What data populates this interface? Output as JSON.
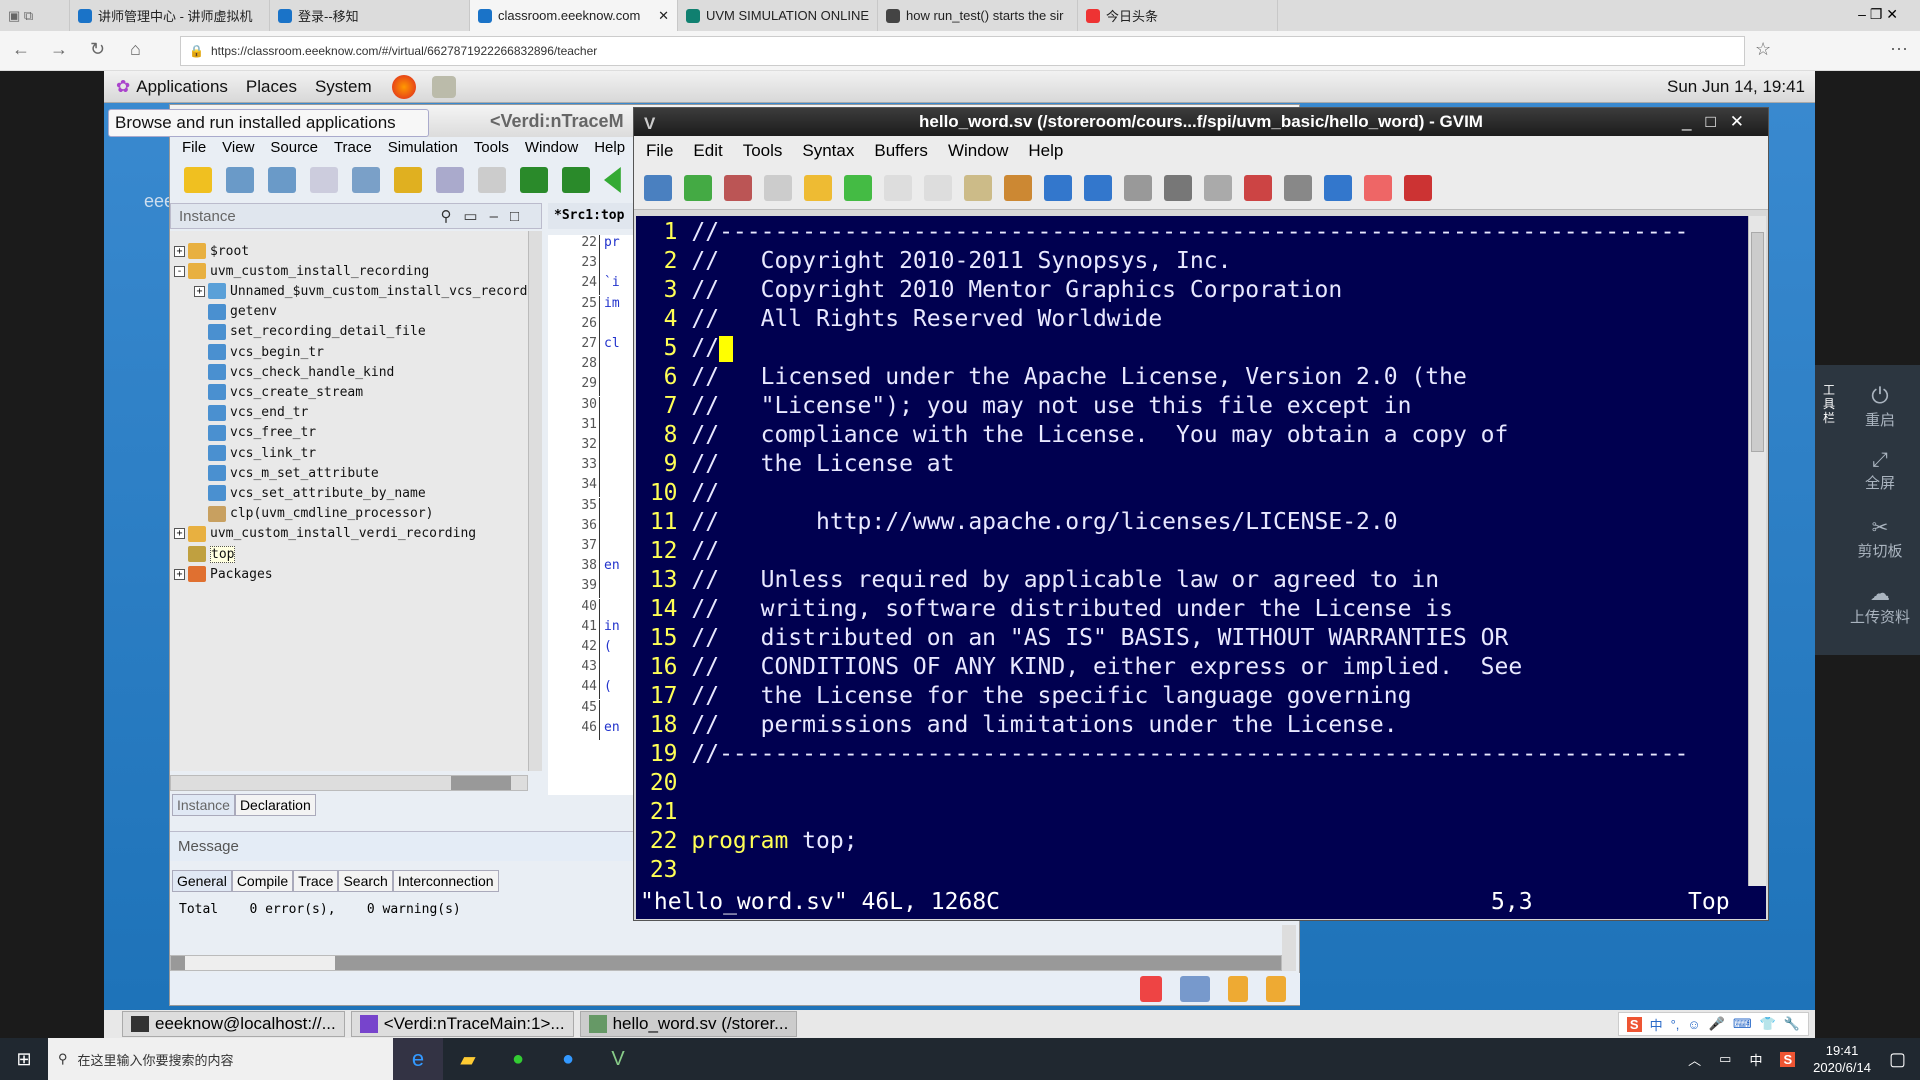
{
  "browser": {
    "tabs": [
      {
        "label": "讲师管理中心 - 讲师虚拟机",
        "color": "#1a73c8",
        "active": false
      },
      {
        "label": "登录--移知",
        "color": "#1a73c8",
        "active": false
      },
      {
        "label": "classroom.eeeknow.com",
        "color": "#1a73c8",
        "active": true
      },
      {
        "label": "UVM SIMULATION ONLINE",
        "color": "#108070",
        "active": false
      },
      {
        "label": "how run_test() starts the sir",
        "color": "#444444",
        "active": false
      },
      {
        "label": "今日头条",
        "color": "#e33",
        "active": false
      }
    ],
    "url": "https://classroom.eeeknow.com/#/virtual/6627871922266832896/teacher"
  },
  "gnome_panel": {
    "menus": [
      "Applications",
      "Places",
      "System"
    ],
    "clock": "Sun Jun 14, 19:41"
  },
  "tooltip": "Browse and run installed applications",
  "desktop_label": "eee",
  "verdi": {
    "title": "<Verdi:nTraceM",
    "menu": [
      "File",
      "View",
      "Source",
      "Trace",
      "Simulation",
      "Tools",
      "Window",
      "Help"
    ],
    "instance_header": "Instance",
    "source_tab": "*Src1:top",
    "tree": [
      {
        "label": "$root",
        "level": 0,
        "expander": "+",
        "icon": "module"
      },
      {
        "label": "uvm_custom_install_recording",
        "level": 0,
        "expander": "-",
        "icon": "module"
      },
      {
        "label": "Unnamed_$uvm_custom_install_vcs_recorde",
        "level": 1,
        "expander": "+",
        "icon": "block"
      },
      {
        "label": "getenv",
        "level": 1,
        "expander": "",
        "icon": "function"
      },
      {
        "label": "set_recording_detail_file",
        "level": 1,
        "expander": "",
        "icon": "function"
      },
      {
        "label": "vcs_begin_tr",
        "level": 1,
        "expander": "",
        "icon": "function"
      },
      {
        "label": "vcs_check_handle_kind",
        "level": 1,
        "expander": "",
        "icon": "function"
      },
      {
        "label": "vcs_create_stream",
        "level": 1,
        "expander": "",
        "icon": "function"
      },
      {
        "label": "vcs_end_tr",
        "level": 1,
        "expander": "",
        "icon": "function"
      },
      {
        "label": "vcs_free_tr",
        "level": 1,
        "expander": "",
        "icon": "function"
      },
      {
        "label": "vcs_link_tr",
        "level": 1,
        "expander": "",
        "icon": "function"
      },
      {
        "label": "vcs_m_set_attribute",
        "level": 1,
        "expander": "",
        "icon": "function"
      },
      {
        "label": "vcs_set_attribute_by_name",
        "level": 1,
        "expander": "",
        "icon": "function"
      },
      {
        "label": "clp(uvm_cmdline_processor)",
        "level": 1,
        "expander": "",
        "icon": "class"
      },
      {
        "label": "uvm_custom_install_verdi_recording",
        "level": 0,
        "expander": "+",
        "icon": "module"
      },
      {
        "label": "top",
        "level": 0,
        "expander": "",
        "icon": "program"
      },
      {
        "label": "Packages",
        "level": 0,
        "expander": "+",
        "icon": "package"
      }
    ],
    "source_lines": [
      {
        "n": "22",
        "t": "pr"
      },
      {
        "n": "23",
        "t": ""
      },
      {
        "n": "24",
        "t": "`i"
      },
      {
        "n": "25",
        "t": "im"
      },
      {
        "n": "26",
        "t": ""
      },
      {
        "n": "27",
        "t": "cl"
      },
      {
        "n": "28",
        "t": ""
      },
      {
        "n": "29",
        "t": ""
      },
      {
        "n": "30",
        "t": ""
      },
      {
        "n": "31",
        "t": ""
      },
      {
        "n": "32",
        "t": ""
      },
      {
        "n": "33",
        "t": ""
      },
      {
        "n": "34",
        "t": ""
      },
      {
        "n": "35",
        "t": ""
      },
      {
        "n": "36",
        "t": ""
      },
      {
        "n": "37",
        "t": ""
      },
      {
        "n": "38",
        "t": "en"
      },
      {
        "n": "39",
        "t": ""
      },
      {
        "n": "40",
        "t": ""
      },
      {
        "n": "41",
        "t": "in"
      },
      {
        "n": "42",
        "t": "("
      },
      {
        "n": "43",
        "t": ""
      },
      {
        "n": "44",
        "t": "("
      },
      {
        "n": "45",
        "t": ""
      },
      {
        "n": "46",
        "t": "en"
      }
    ],
    "bottom_tabs": [
      "Instance",
      "Declaration"
    ],
    "message_header": "Message",
    "message_tabs": [
      "General",
      "Compile",
      "Trace",
      "Search",
      "Interconnection"
    ],
    "message_text": "Total    0 error(s),    0 warning(s)"
  },
  "gvim": {
    "title": "hello_word.sv (/storeroom/cours...f/spi/uvm_basic/hello_word) - GVIM",
    "menu": [
      "File",
      "Edit",
      "Tools",
      "Syntax",
      "Buffers",
      "Window",
      "Help"
    ],
    "lines": [
      {
        "n": "1",
        "t": "//----------------------------------------------------------------------"
      },
      {
        "n": "2",
        "t": "//   Copyright 2010-2011 Synopsys, Inc."
      },
      {
        "n": "3",
        "t": "//   Copyright 2010 Mentor Graphics Corporation"
      },
      {
        "n": "4",
        "t": "//   All Rights Reserved Worldwide"
      },
      {
        "n": "5",
        "t": "//"
      },
      {
        "n": "6",
        "t": "//   Licensed under the Apache License, Version 2.0 (the"
      },
      {
        "n": "7",
        "t": "//   \"License\"); you may not use this file except in"
      },
      {
        "n": "8",
        "t": "//   compliance with the License.  You may obtain a copy of"
      },
      {
        "n": "9",
        "t": "//   the License at"
      },
      {
        "n": "10",
        "t": "//"
      },
      {
        "n": "11",
        "t": "//       http://www.apache.org/licenses/LICENSE-2.0"
      },
      {
        "n": "12",
        "t": "//"
      },
      {
        "n": "13",
        "t": "//   Unless required by applicable law or agreed to in"
      },
      {
        "n": "14",
        "t": "//   writing, software distributed under the License is"
      },
      {
        "n": "15",
        "t": "//   distributed on an \"AS IS\" BASIS, WITHOUT WARRANTIES OR"
      },
      {
        "n": "16",
        "t": "//   CONDITIONS OF ANY KIND, either express or implied.  See"
      },
      {
        "n": "17",
        "t": "//   the License for the specific language governing"
      },
      {
        "n": "18",
        "t": "//   permissions and limitations under the License."
      },
      {
        "n": "19",
        "t": "//----------------------------------------------------------------------"
      },
      {
        "n": "20",
        "t": ""
      },
      {
        "n": "21",
        "t": ""
      },
      {
        "n": "22",
        "kw": "program",
        "t": " top;"
      },
      {
        "n": "23",
        "t": ""
      }
    ],
    "status_file": "\"hello_word.sv\" 46L, 1268C",
    "status_pos": "5,3",
    "status_scroll": "Top"
  },
  "remote_taskbar": [
    "eeeknow@localhost://...",
    "<Verdi:nTraceMain:1>...",
    "hello_word.sv (/storer..."
  ],
  "side_toolbar": {
    "label": "工具栏",
    "items": [
      "重启",
      "全屏",
      "剪切板",
      "上传资料"
    ]
  },
  "windows_taskbar": {
    "search_placeholder": "在这里输入你要搜索的内容",
    "time": "19:41",
    "date": "2020/6/14",
    "ime": "中"
  },
  "colors": {
    "vim_bg": "#000050",
    "vim_linenr": "#ffff55",
    "desktop": "#2a7fc0"
  }
}
